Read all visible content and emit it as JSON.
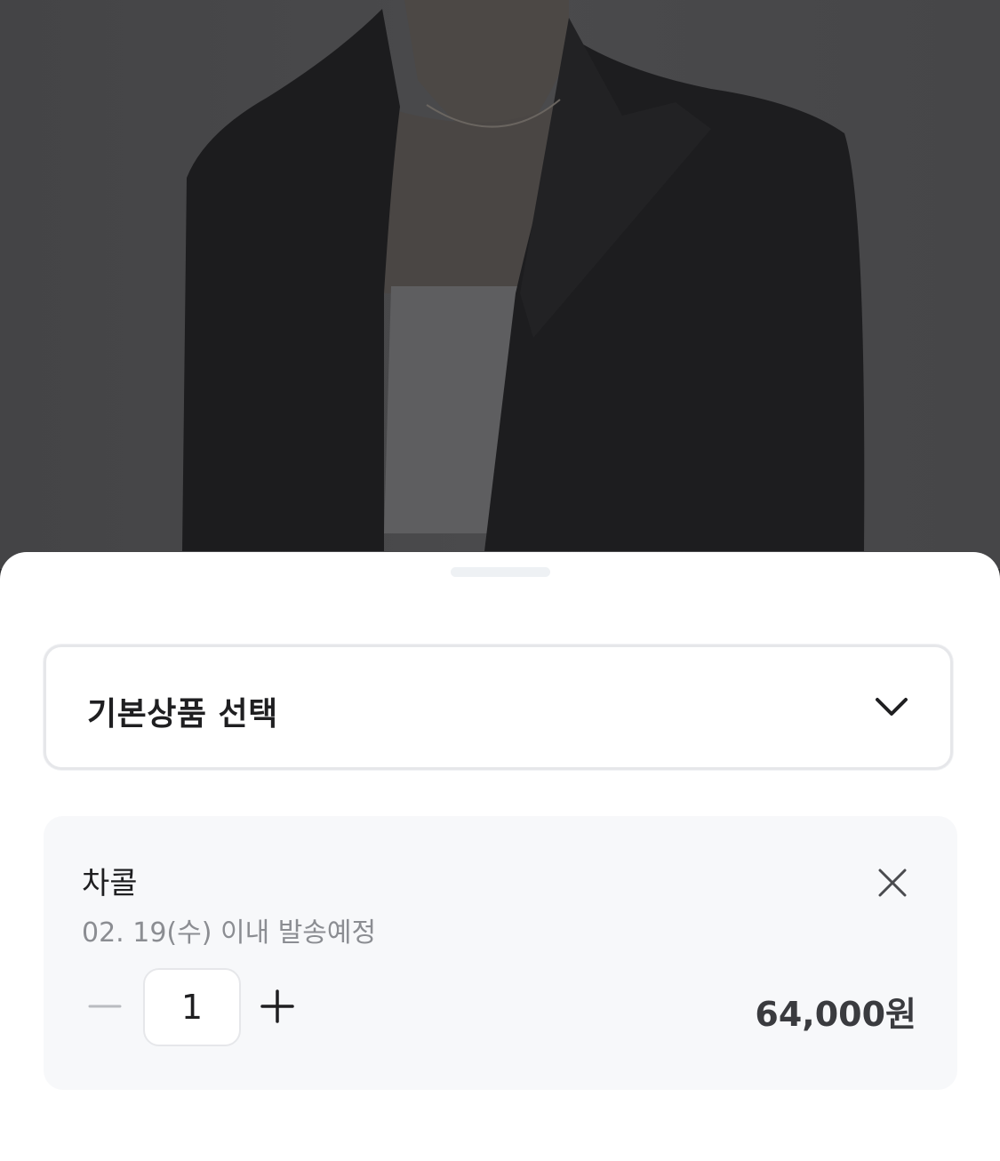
{
  "option_select": {
    "label": "기본상품 선택",
    "icon": "chevron-down-icon"
  },
  "selected_item": {
    "name": "차콜",
    "shipping_note": "02. 19(수) 이내 발송예정",
    "quantity": "1",
    "price": "64,000원",
    "remove_icon": "close-icon",
    "decrease_icon": "minus-icon",
    "increase_icon": "plus-icon"
  },
  "colors": {
    "sheet_background": "#ffffff",
    "item_card_background": "#f7f8fa",
    "primary_text": "#1f1f21",
    "secondary_text": "#8b8d92",
    "border": "#e6e7ea"
  }
}
